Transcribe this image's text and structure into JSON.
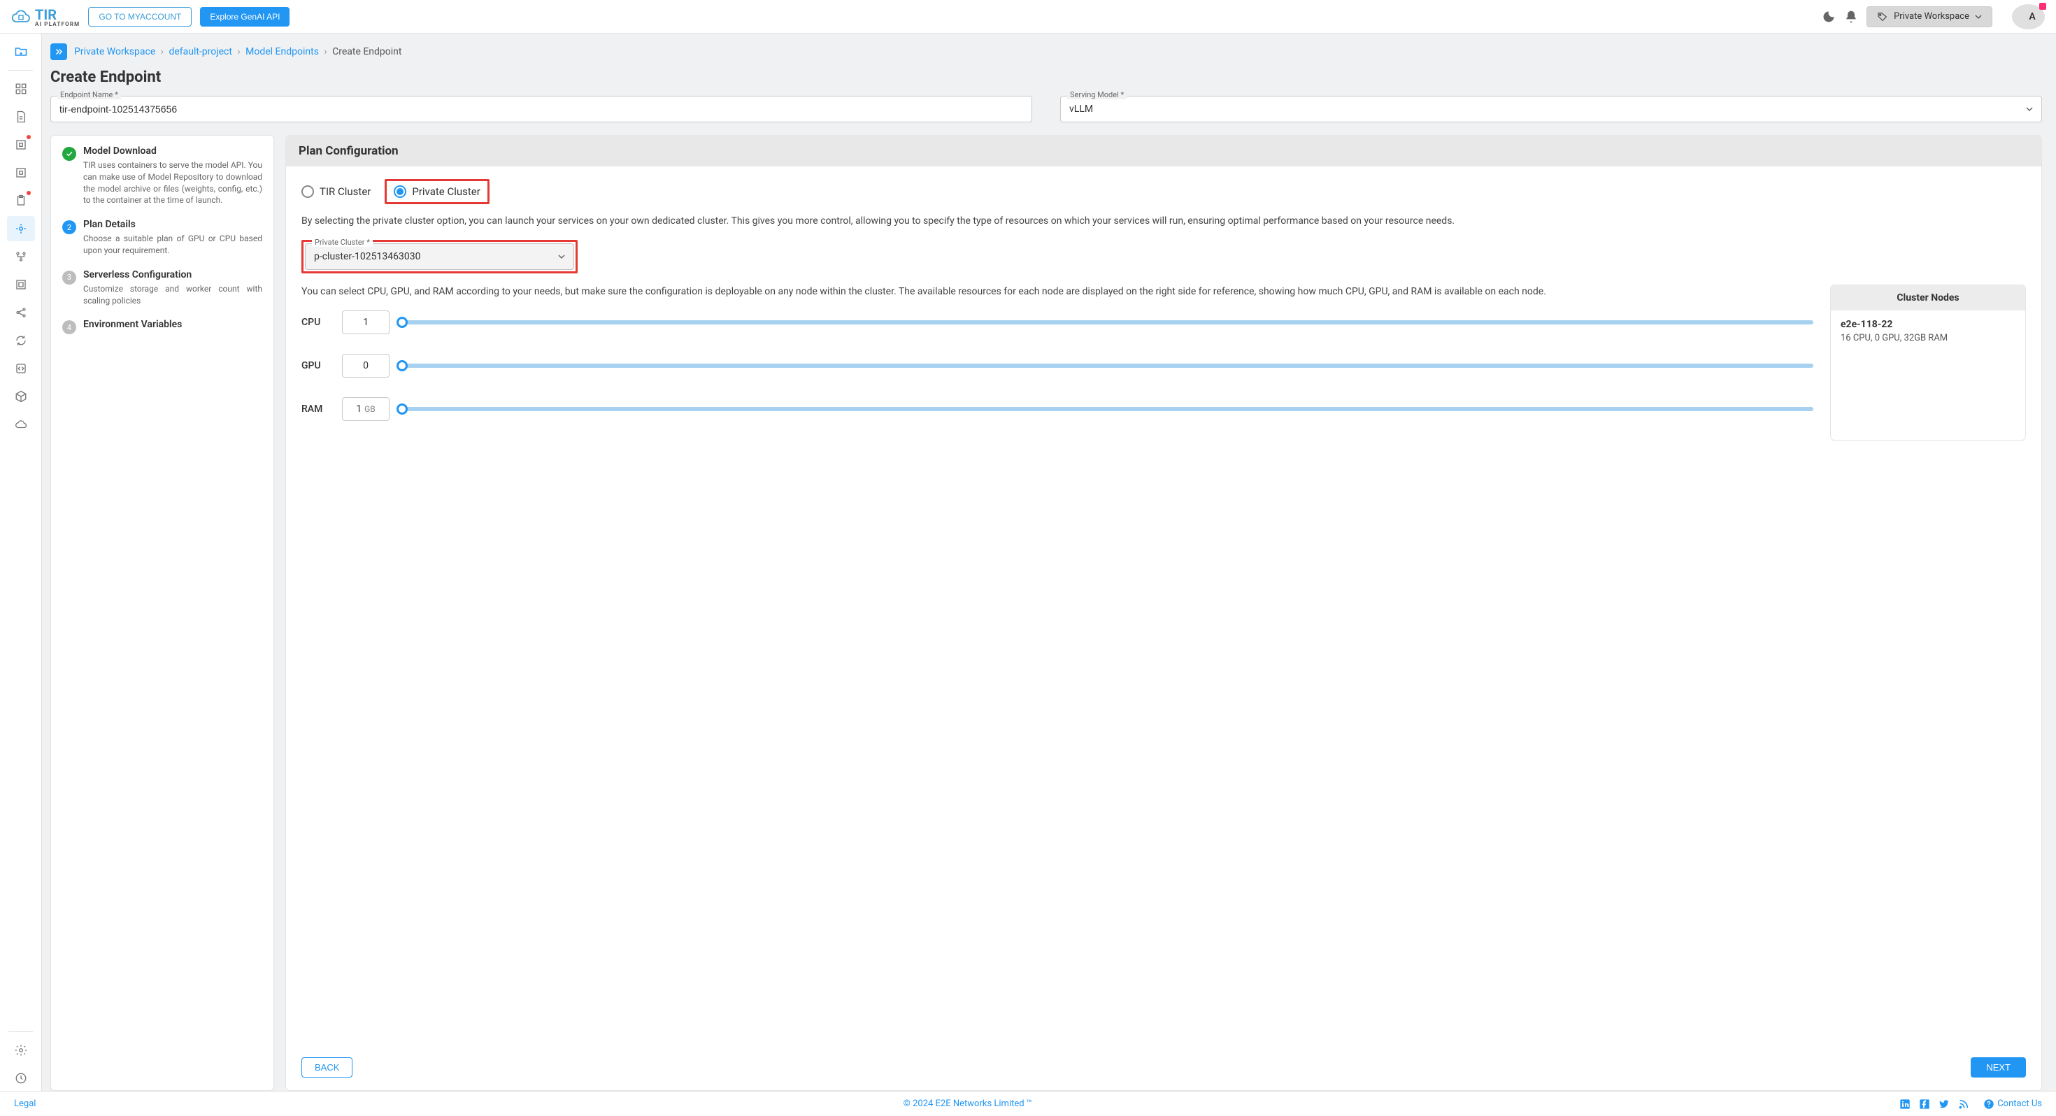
{
  "topbar": {
    "logo_name": "TIR",
    "logo_sub": "AI PLATFORM",
    "go_myaccount": "GO TO MYACCOUNT",
    "explore_genai": "Explore GenAI API",
    "workspace_label": "Private Workspace",
    "avatar_letter": "A"
  },
  "breadcrumb": {
    "items": [
      "Private Workspace",
      "default-project",
      "Model Endpoints"
    ],
    "current": "Create Endpoint"
  },
  "page_title": "Create Endpoint",
  "form": {
    "endpoint_label": "Endpoint Name *",
    "endpoint_value": "tir-endpoint-102514375656",
    "serving_label": "Serving Model *",
    "serving_value": "vLLM"
  },
  "wizard": {
    "steps": [
      {
        "title": "Model Download",
        "desc": "TIR uses containers to serve the model API. You can make use of Model Repository to download the model archive or files (weights, config, etc.) to the container at the time of launch.",
        "state": "done"
      },
      {
        "title": "Plan Details",
        "desc": "Choose a suitable plan of GPU or CPU based upon your requirement.",
        "state": "active",
        "num": "2"
      },
      {
        "title": "Serverless Configuration",
        "desc": "Customize storage and worker count with scaling policies",
        "state": "pending",
        "num": "3"
      },
      {
        "title": "Environment Variables",
        "desc": "",
        "state": "pending",
        "num": "4"
      }
    ]
  },
  "panel": {
    "header": "Plan Configuration",
    "radio": {
      "tir": "TIR Cluster",
      "private": "Private Cluster"
    },
    "cluster_desc": "By selecting the private cluster option, you can launch your services on your own dedicated cluster. This gives you more control, allowing you to specify the type of resources on which your services will run, ensuring optimal performance based on your resource needs.",
    "cluster_label": "Private Cluster *",
    "cluster_value": "p-cluster-102513463030",
    "resource_desc": "You can select CPU, GPU, and RAM according to your needs, but make sure the configuration is deployable on any node within the cluster. The available resources for each node are displayed on the right side for reference, showing how much CPU, GPU, and RAM is available on each node.",
    "cpu_label": "CPU",
    "cpu_value": "1",
    "gpu_label": "GPU",
    "gpu_value": "0",
    "ram_label": "RAM",
    "ram_value": "1",
    "ram_unit": "GB",
    "nodes_header": "Cluster Nodes",
    "node_name": "e2e-118-22",
    "node_specs": "16 CPU, 0 GPU, 32GB RAM",
    "back": "BACK",
    "next": "NEXT"
  },
  "footer": {
    "legal": "Legal",
    "copyright": "© 2024 E2E Networks Limited ™",
    "contact": "Contact Us"
  }
}
